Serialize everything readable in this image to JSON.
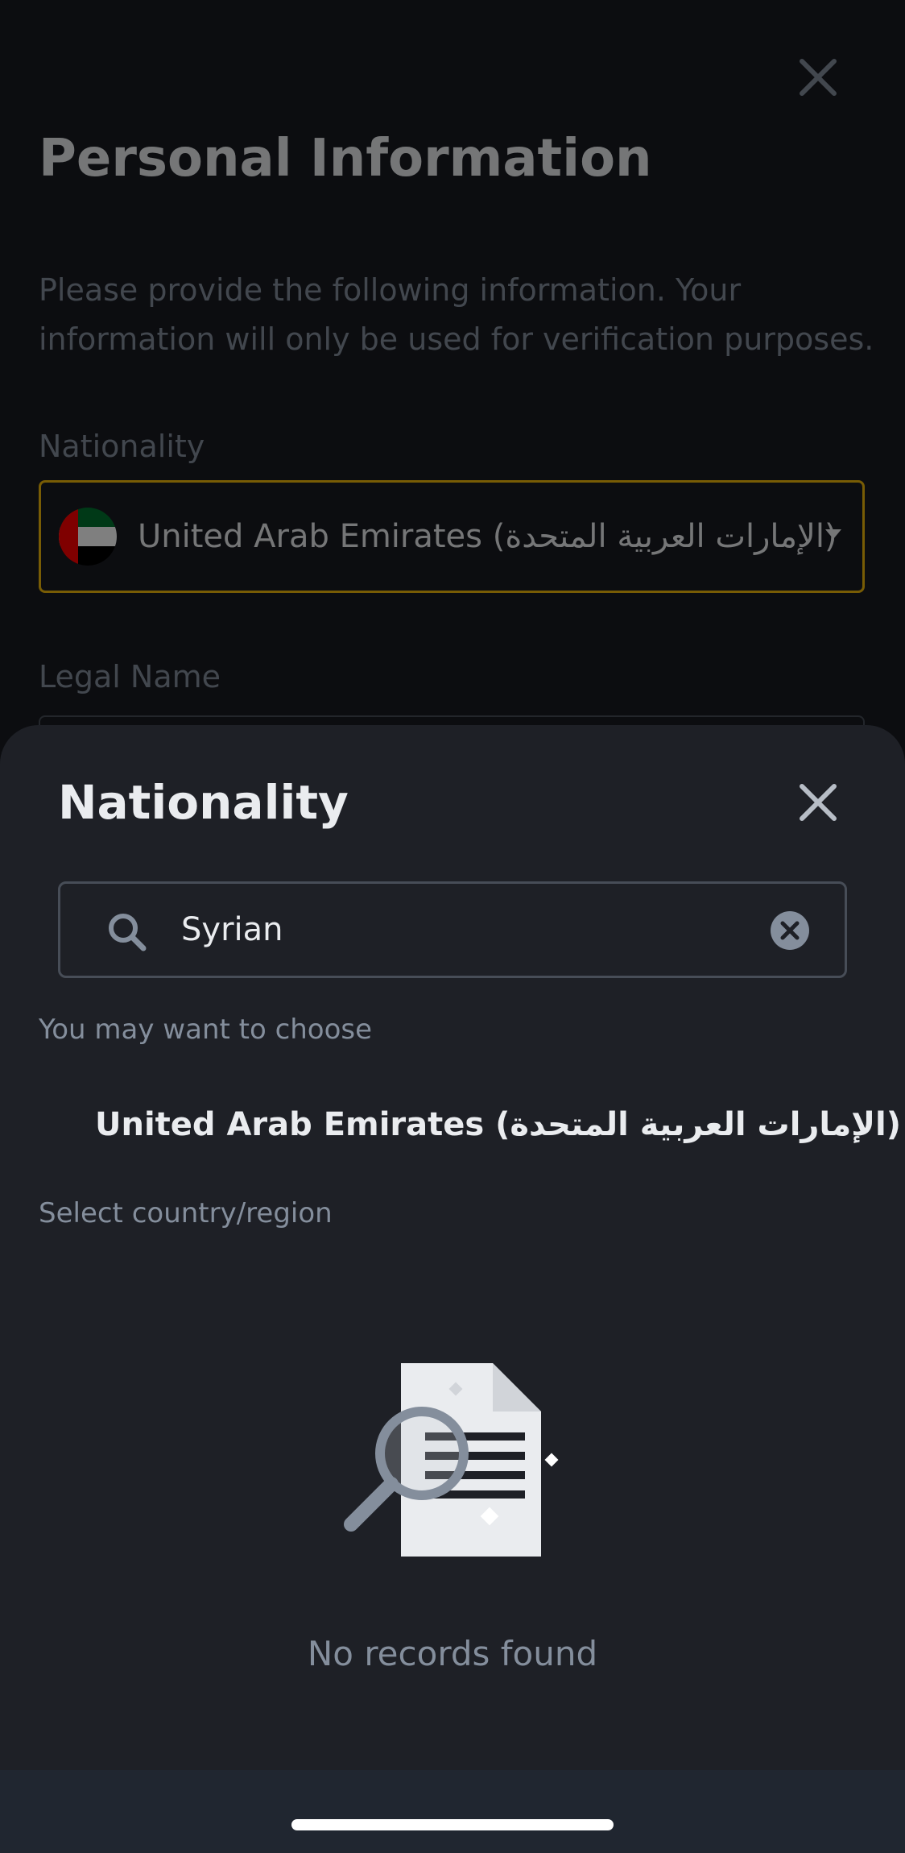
{
  "background_page": {
    "title": "Personal Information",
    "description": "Please provide the following information. Your information will only be used for verification purposes.",
    "nationality_label": "Nationality",
    "nationality_value": "United Arab Emirates (الإمارات العربية المتحدة)",
    "legal_name_label": "Legal Name"
  },
  "sheet": {
    "title": "Nationality",
    "search": {
      "value": "Syrian"
    },
    "suggestion_label": "You may want to choose",
    "suggestion": {
      "country": "United Arab Emirates (الإمارات العربية المتحدة)",
      "flag_icon": "uae-flag-icon"
    },
    "select_label": "Select country/region",
    "empty_state": {
      "icon": "no-records-illustration",
      "text": "No records found"
    }
  },
  "colors": {
    "page_bg": "#181a20",
    "sheet_bg": "#1e2026",
    "accent": "#f0b90b",
    "text_primary": "#eaecef",
    "text_secondary": "#848e9c",
    "border": "#474d57",
    "uae_green": "#00732f",
    "uae_red": "#ff0000"
  }
}
